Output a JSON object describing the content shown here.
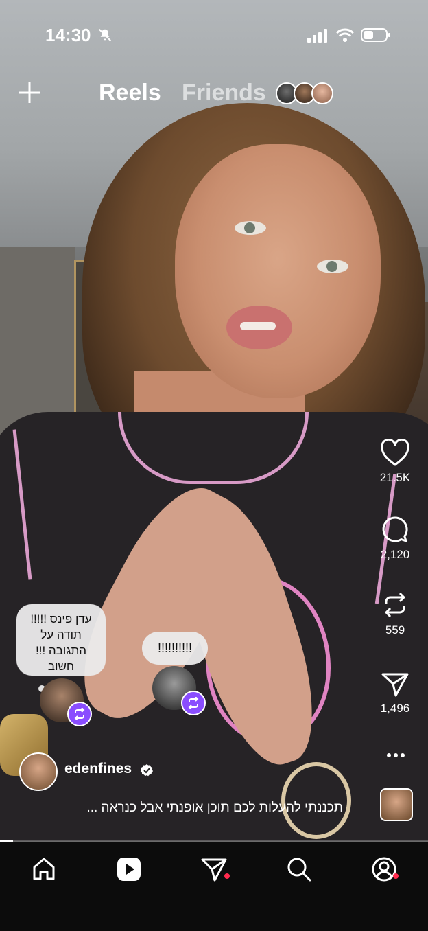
{
  "status_bar": {
    "time": "14:30",
    "icons": [
      "bell-mute-icon",
      "signal-icon",
      "wifi-icon",
      "battery-icon"
    ]
  },
  "top_nav": {
    "create_icon": "plus-icon",
    "tabs": [
      {
        "label": "Reels",
        "active": true
      },
      {
        "label": "Friends",
        "active": false
      }
    ]
  },
  "actions": {
    "like_count": "21.5K",
    "comment_count": "2,120",
    "repost_count": "559",
    "share_count": "1,496"
  },
  "notes": [
    {
      "text_lines": [
        "עדן פינס !!!!!",
        "תודה על",
        "התגובה !!!",
        "חשוב"
      ]
    },
    {
      "text": "!!!!!!!!!!"
    }
  ],
  "author": {
    "username": "edenfines",
    "verified": true
  },
  "caption": "תכננתי להעלות לכם תוכן אופנתי אבל כנראה ...",
  "progress": 0.03,
  "tabbar": {
    "items": [
      "home-icon",
      "reels-icon",
      "direct-messages-icon",
      "search-icon",
      "profile-icon"
    ]
  },
  "colors": {
    "accent_purple": "#8a4dff",
    "notification_red": "#ff2a4d",
    "tabbar_bg": "#0c0c0c"
  }
}
